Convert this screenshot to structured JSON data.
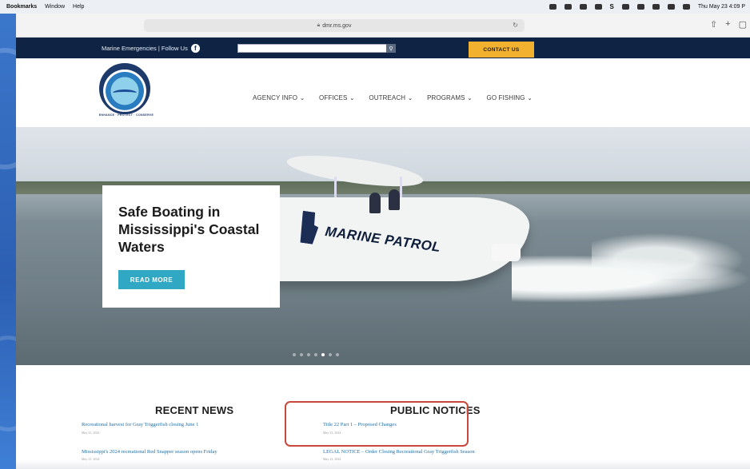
{
  "menubar": {
    "items": [
      "Bookmarks",
      "Window",
      "Help"
    ],
    "status_s": "S",
    "clock": "Thu May 23  4:09 P"
  },
  "browser": {
    "url": "dmr.ms.gov"
  },
  "topbar": {
    "emergency_text": "Marine Emergencies | Follow Us",
    "facebook_glyph": "f",
    "search_placeholder": "",
    "contact_label": "CONTACT US"
  },
  "header": {
    "logo_tagline": "ENHANCE · PROTECT · CONSERVE",
    "nav": [
      {
        "label": "AGENCY INFO"
      },
      {
        "label": "OFFICES"
      },
      {
        "label": "OUTREACH"
      },
      {
        "label": "PROGRAMS"
      },
      {
        "label": "GO FISHING"
      }
    ]
  },
  "hero": {
    "title": "Safe Boating in Mississippi's Coastal Waters",
    "button_label": "READ MORE",
    "boat_text": "MARINE PATROL",
    "slide_count": 7,
    "active_slide": 4
  },
  "recent_news": {
    "title": "RECENT NEWS",
    "items": [
      {
        "title": "Recreational harvest for Gray Triggerfish closing June 1",
        "date": "May 22, 2024"
      },
      {
        "title": "Mississippi's 2024 recreational Red Snapper season opens Friday",
        "date": "May 21, 2024"
      }
    ]
  },
  "public_notices": {
    "title": "PUBLIC NOTICES",
    "items": [
      {
        "title": "Title 22 Part 1 – Proposed Changes",
        "date": "May 23, 2024"
      },
      {
        "title": "LEGAL NOTICE – Order Closing Recreational Gray Triggerfish Season",
        "date": "May 22, 2024"
      }
    ]
  },
  "colors": {
    "topbar": "#0f2445",
    "contact": "#f2b230",
    "accent": "#30a8c4",
    "link": "#1f6fa8",
    "highlight": "#c8483c"
  }
}
